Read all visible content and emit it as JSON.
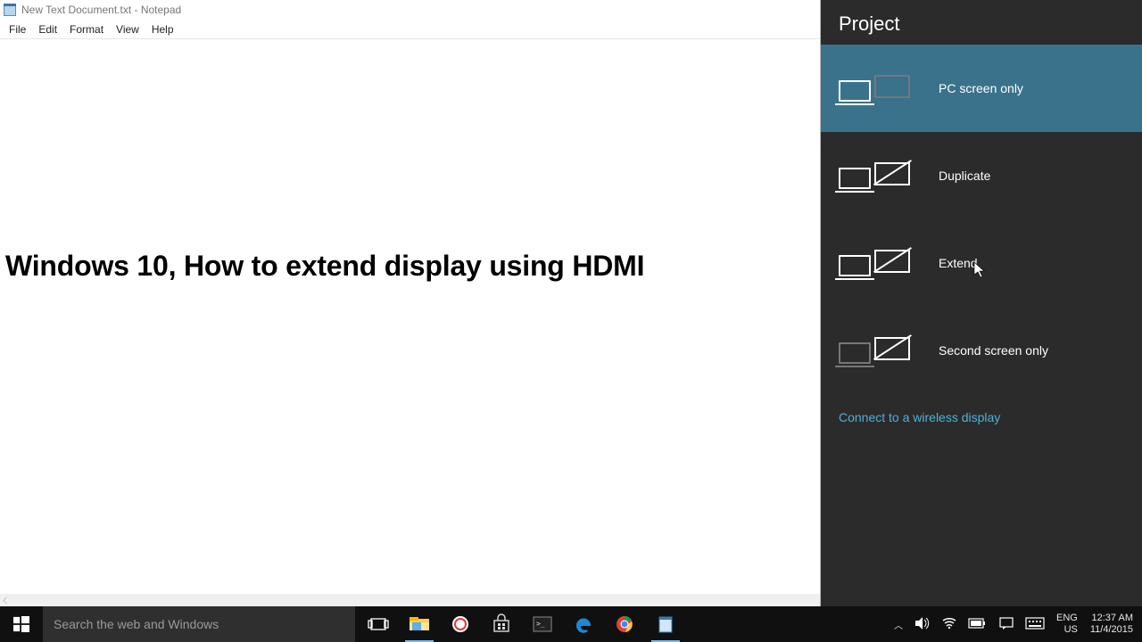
{
  "notepad": {
    "title": "New Text Document.txt - Notepad",
    "menus": [
      "File",
      "Edit",
      "Format",
      "View",
      "Help"
    ],
    "content": "Windows 10, How to extend display using HDMI"
  },
  "project": {
    "title": "Project",
    "items": [
      {
        "label": "PC screen only"
      },
      {
        "label": "Duplicate"
      },
      {
        "label": "Extend"
      },
      {
        "label": "Second screen only"
      }
    ],
    "wireless_link": "Connect to a wireless display"
  },
  "taskbar": {
    "search_placeholder": "Search the web and Windows",
    "tray": {
      "lang1": "ENG",
      "lang2": "US",
      "time": "12:37 AM",
      "date": "11/4/2015"
    }
  }
}
